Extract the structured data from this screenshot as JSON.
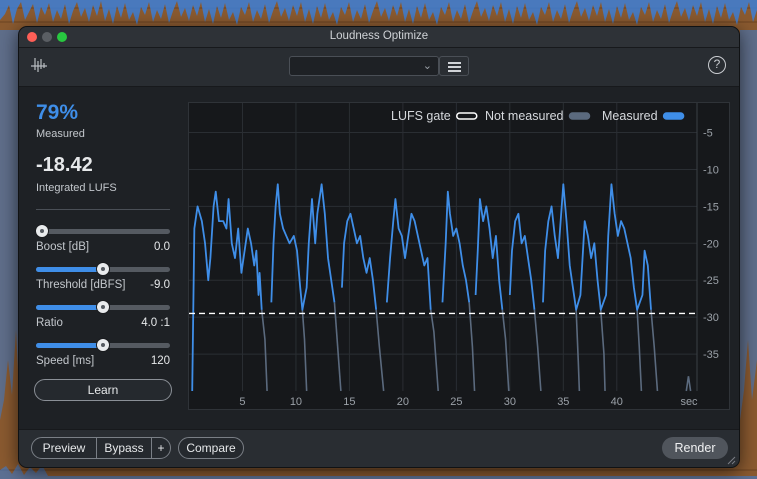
{
  "window": {
    "title": "Loudness Optimize"
  },
  "toolbar": {
    "preset_value": "",
    "help_label": "?"
  },
  "stats": {
    "measured_pct": "79%",
    "measured_label": "Measured",
    "integrated_value": "-18.42",
    "integrated_label": "Integrated LUFS"
  },
  "params": [
    {
      "name": "Boost [dB]",
      "value": "0.0",
      "fraction": 0.0
    },
    {
      "name": "Threshold [dBFS]",
      "value": "-9.0",
      "fraction": 0.5
    },
    {
      "name": "Ratio",
      "value": "4.0 :1",
      "fraction": 0.5
    },
    {
      "name": "Speed [ms]",
      "value": "120",
      "fraction": 0.5
    }
  ],
  "learn_label": "Learn",
  "legend": {
    "gate": "LUFS gate",
    "not_measured": "Not measured",
    "measured": "Measured"
  },
  "colors": {
    "accent": "#3f8ee8",
    "not_measured": "#5b6a7e",
    "gate": "#ffffff"
  },
  "chart_data": {
    "type": "line",
    "xlabel": "sec",
    "x_ticks": [
      5,
      10,
      15,
      20,
      25,
      30,
      35,
      40
    ],
    "y_ticks": [
      -5,
      -10,
      -15,
      -20,
      -25,
      -30,
      -35
    ],
    "xlim": [
      0,
      47.5
    ],
    "ylim": [
      -40,
      -1
    ],
    "gate_level": -29.5,
    "legend_position": "top-right",
    "series": [
      {
        "name": "Measured",
        "color": "#3f8ee8",
        "points": [
          [
            0.3,
            -40
          ],
          [
            0.5,
            -18
          ],
          [
            0.8,
            -15
          ],
          [
            1.2,
            -17
          ],
          [
            1.5,
            -20
          ],
          [
            1.8,
            -25
          ],
          [
            2.0,
            -22
          ],
          [
            2.3,
            -15
          ],
          [
            2.5,
            -13
          ],
          [
            2.8,
            -17
          ],
          [
            3.2,
            -17
          ],
          [
            3.5,
            -18
          ],
          [
            3.7,
            -14
          ],
          [
            4.0,
            -20
          ],
          [
            4.3,
            -22
          ],
          [
            4.6,
            -18
          ],
          [
            4.9,
            -24
          ],
          [
            5.2,
            -21
          ],
          [
            5.5,
            -18
          ],
          [
            5.8,
            -20
          ],
          [
            6.1,
            -23
          ],
          [
            6.3,
            -21
          ],
          [
            6.5,
            -27
          ],
          [
            6.6,
            -24
          ],
          [
            6.8,
            -29
          ],
          [
            7.7,
            -28
          ],
          [
            7.9,
            -20
          ],
          [
            8.1,
            -15
          ],
          [
            8.3,
            -12
          ],
          [
            8.5,
            -16
          ],
          [
            8.8,
            -18
          ],
          [
            9.1,
            -19
          ],
          [
            9.4,
            -20
          ],
          [
            9.8,
            -19
          ],
          [
            10.1,
            -21
          ],
          [
            10.4,
            -26
          ],
          [
            10.6,
            -29
          ],
          [
            11.0,
            -26
          ],
          [
            11.2,
            -20
          ],
          [
            11.5,
            -14
          ],
          [
            11.8,
            -20
          ],
          [
            12.0,
            -16
          ],
          [
            12.4,
            -12
          ],
          [
            12.7,
            -16
          ],
          [
            13.0,
            -22
          ],
          [
            13.3,
            -25
          ],
          [
            13.6,
            -28
          ],
          [
            14.3,
            -26
          ],
          [
            14.5,
            -20
          ],
          [
            14.8,
            -17
          ],
          [
            15.1,
            -16
          ],
          [
            15.4,
            -18
          ],
          [
            15.7,
            -20
          ],
          [
            16.0,
            -19
          ],
          [
            16.3,
            -22
          ],
          [
            16.6,
            -24
          ],
          [
            16.9,
            -22
          ],
          [
            17.2,
            -25
          ],
          [
            17.5,
            -29
          ],
          [
            18.5,
            -28
          ],
          [
            18.8,
            -22
          ],
          [
            19.1,
            -17
          ],
          [
            19.3,
            -14
          ],
          [
            19.6,
            -18
          ],
          [
            19.9,
            -19
          ],
          [
            20.2,
            -22
          ],
          [
            20.5,
            -19
          ],
          [
            20.8,
            -16
          ],
          [
            21.1,
            -17
          ],
          [
            21.4,
            -19
          ],
          [
            21.7,
            -21
          ],
          [
            22.0,
            -23
          ],
          [
            22.3,
            -22
          ],
          [
            22.6,
            -29
          ],
          [
            23.7,
            -28
          ],
          [
            24.0,
            -20
          ],
          [
            24.2,
            -13
          ],
          [
            24.4,
            -16
          ],
          [
            24.7,
            -19
          ],
          [
            25.0,
            -18
          ],
          [
            25.3,
            -20
          ],
          [
            25.6,
            -23
          ],
          [
            25.9,
            -25
          ],
          [
            26.2,
            -28
          ],
          [
            26.8,
            -27
          ],
          [
            27.0,
            -21
          ],
          [
            27.2,
            -14
          ],
          [
            27.5,
            -17
          ],
          [
            27.8,
            -15
          ],
          [
            28.1,
            -18
          ],
          [
            28.4,
            -22
          ],
          [
            28.7,
            -19
          ],
          [
            29.0,
            -25
          ],
          [
            29.3,
            -29
          ],
          [
            30.0,
            -27
          ],
          [
            30.2,
            -21
          ],
          [
            30.5,
            -17
          ],
          [
            30.8,
            -16
          ],
          [
            31.1,
            -20
          ],
          [
            31.4,
            -19
          ],
          [
            31.7,
            -22
          ],
          [
            32.0,
            -25
          ],
          [
            32.3,
            -29
          ],
          [
            33.1,
            -28
          ],
          [
            33.3,
            -21
          ],
          [
            33.6,
            -17
          ],
          [
            33.9,
            -15
          ],
          [
            34.2,
            -19
          ],
          [
            34.5,
            -22
          ],
          [
            34.7,
            -18
          ],
          [
            35.0,
            -12
          ],
          [
            35.3,
            -17
          ],
          [
            35.6,
            -23
          ],
          [
            35.9,
            -26
          ],
          [
            36.2,
            -29
          ],
          [
            36.6,
            -27
          ],
          [
            36.8,
            -22
          ],
          [
            37.0,
            -17
          ],
          [
            37.3,
            -19
          ],
          [
            37.6,
            -22
          ],
          [
            37.9,
            -20
          ],
          [
            38.2,
            -25
          ],
          [
            38.5,
            -29
          ],
          [
            39.0,
            -27
          ],
          [
            39.2,
            -19
          ],
          [
            39.5,
            -12
          ],
          [
            39.8,
            -16
          ],
          [
            40.1,
            -19
          ],
          [
            40.4,
            -17
          ],
          [
            40.7,
            -18
          ],
          [
            41.0,
            -20
          ],
          [
            41.3,
            -22
          ],
          [
            41.6,
            -26
          ],
          [
            41.9,
            -29
          ],
          [
            42.4,
            -27
          ],
          [
            42.6,
            -21
          ],
          [
            42.9,
            -23
          ],
          [
            43.2,
            -29
          ]
        ]
      },
      {
        "name": "Not measured",
        "color": "#5b6a7e",
        "segments": [
          [
            [
              6.8,
              -29
            ],
            [
              7.1,
              -33
            ],
            [
              7.3,
              -40
            ]
          ],
          [
            [
              10.6,
              -29
            ],
            [
              10.8,
              -33
            ],
            [
              11.0,
              -40
            ]
          ],
          [
            [
              13.6,
              -28
            ],
            [
              13.9,
              -34
            ],
            [
              14.2,
              -40
            ]
          ],
          [
            [
              17.5,
              -29
            ],
            [
              17.8,
              -34
            ],
            [
              18.2,
              -40
            ]
          ],
          [
            [
              22.6,
              -29
            ],
            [
              22.9,
              -32
            ],
            [
              23.3,
              -40
            ]
          ],
          [
            [
              26.2,
              -28
            ],
            [
              26.5,
              -34
            ],
            [
              26.7,
              -40
            ]
          ],
          [
            [
              29.3,
              -29
            ],
            [
              29.6,
              -33
            ],
            [
              29.9,
              -40
            ]
          ],
          [
            [
              32.3,
              -29
            ],
            [
              32.6,
              -34
            ],
            [
              32.9,
              -40
            ]
          ],
          [
            [
              36.2,
              -29
            ],
            [
              36.4,
              -36
            ],
            [
              36.5,
              -40
            ]
          ],
          [
            [
              38.5,
              -29
            ],
            [
              38.8,
              -35
            ],
            [
              38.9,
              -40
            ]
          ],
          [
            [
              41.9,
              -29
            ],
            [
              42.1,
              -34
            ],
            [
              42.3,
              -40
            ]
          ],
          [
            [
              43.2,
              -29
            ],
            [
              43.5,
              -34
            ],
            [
              43.8,
              -40
            ]
          ],
          [
            [
              46.5,
              -40
            ],
            [
              46.7,
              -38
            ],
            [
              46.9,
              -40
            ]
          ]
        ]
      }
    ]
  },
  "bottom": {
    "preview": "Preview",
    "bypass": "Bypass",
    "plus": "+",
    "compare": "Compare",
    "render": "Render"
  }
}
